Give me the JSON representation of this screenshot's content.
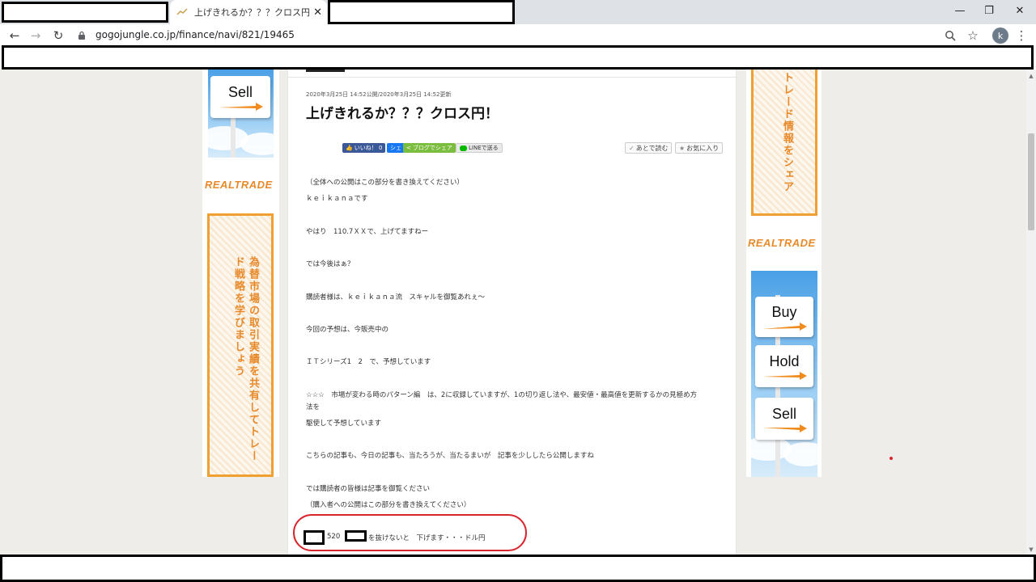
{
  "browser": {
    "active_tab_title": "上げきれるか？？？クロス円！ - Ke",
    "url": "gogojungle.co.jp/finance/navi/821/19465",
    "profile_initial": "k"
  },
  "ads_left": {
    "sign_label": "Sell",
    "logo_text": "REALTRADE",
    "banner_text": "為替市場の取引実績を共有してトレード戦略を学びましょう"
  },
  "ads_right": {
    "banner_text": "トレード情報をシェア",
    "logo_text": "REALTRADE",
    "signs": [
      "Buy",
      "Hold",
      "Sell"
    ]
  },
  "post": {
    "date": "2020年3月25日 14:52公開/2020年3月25日 14:52更新",
    "title": "上げきれるか？？？クロス円！",
    "share_buttons": {
      "like": "いいね！ 0",
      "share": "シェ",
      "blog": "ブログでシェア",
      "line": "LINEで送る"
    },
    "action_buttons": {
      "read_later": "あとで読む",
      "favorite": "お気に入り"
    },
    "paragraphs": [
      "（全体への公開はこの部分を書き換えてください）",
      "ｋｅｉｋａｎａです",
      "やはり　110.7ＸＸで、上げてますねー",
      "では今後はぁ？",
      "購読者様は、ｋｅｉｋａｎａ流　スキャルを御覧あれぇ～",
      "今回の予想は、今販売中の",
      "ＩＴシリーズ1　2　で、予想しています",
      "☆☆☆　市場が変わる時のパターン編　は、2に収録していますが、1の切り返し法や、最安値・最高値を更新するかの見極め方",
      "法を",
      "駆使して予想しています",
      "こちらの記事も、今日の記事も、当たろうが、当たるまいが　記事を少ししたら公開しますね",
      "では購読者の皆様は記事を御覧ください",
      "（購入者への公開はこの部分を書き換えてください）"
    ],
    "highlight": {
      "number": "520",
      "text": "を抜けないと　下げます・・・ドル円"
    }
  }
}
